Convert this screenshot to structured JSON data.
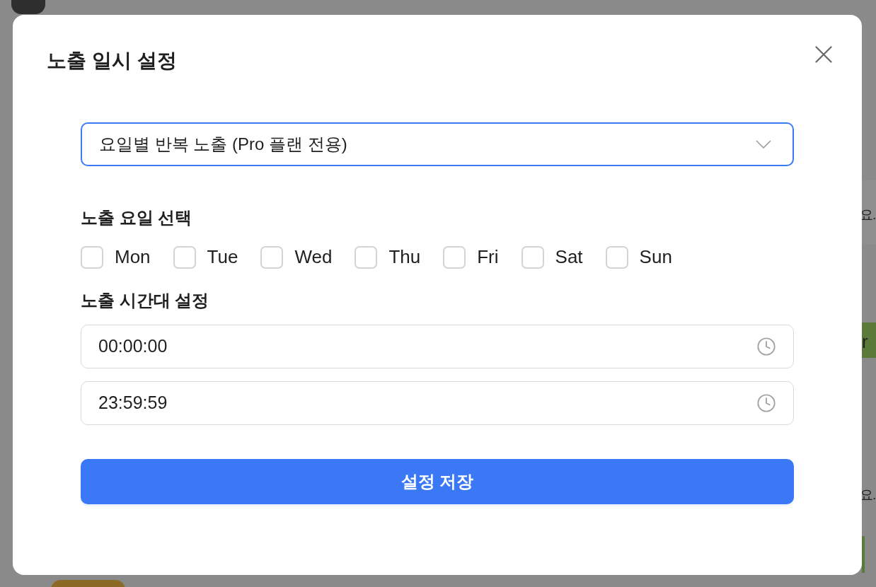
{
  "background": {
    "fragments": [
      "요.",
      "r",
      "요."
    ]
  },
  "dialog": {
    "title": "노출 일시 설정",
    "mode_select": {
      "value": "요일별 반복 노출 (Pro 플랜 전용)"
    },
    "days_label": "노출 요일 선택",
    "days": [
      {
        "label": "Mon",
        "checked": false
      },
      {
        "label": "Tue",
        "checked": false
      },
      {
        "label": "Wed",
        "checked": false
      },
      {
        "label": "Thu",
        "checked": false
      },
      {
        "label": "Fri",
        "checked": false
      },
      {
        "label": "Sat",
        "checked": false
      },
      {
        "label": "Sun",
        "checked": false
      }
    ],
    "time_label": "노출 시간대 설정",
    "start_time": {
      "value": "00:00:00"
    },
    "end_time": {
      "value": "23:59:59"
    },
    "save_button": "설정 저장"
  }
}
